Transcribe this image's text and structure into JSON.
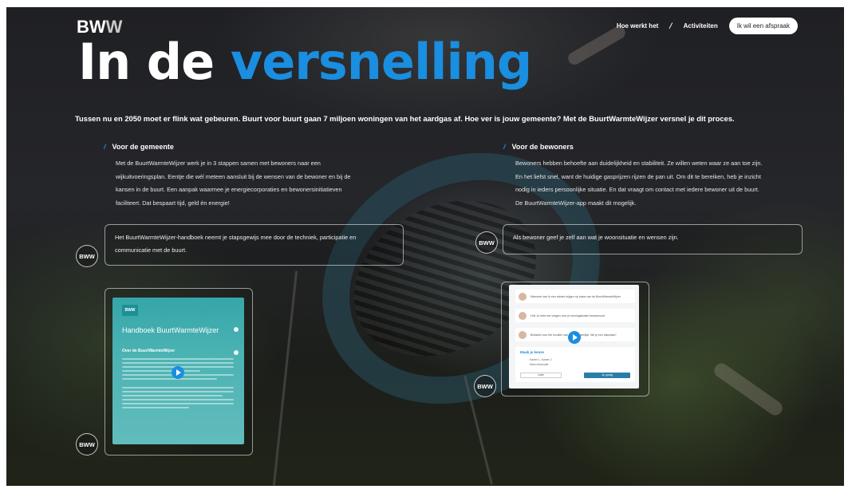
{
  "brand": {
    "logo_text_main": "BW",
    "logo_text_w": "W"
  },
  "nav": {
    "link_how": "Hoe werkt het",
    "separator": "/",
    "link_activities": "Activiteiten",
    "cta": "Ik wil een afspraak"
  },
  "hero": {
    "title_part1": "In de",
    "title_accent": "versnelling"
  },
  "intro": "Tussen nu en 2050 moet er flink wat gebeuren. Buurt voor buurt gaan 7 miljoen woningen van het aardgas af. Hoe ver is jouw gemeente? Met de BuurtWarmteWijzer versnel je dit proces.",
  "gemeente": {
    "heading": "Voor de gemeente",
    "lines": [
      "Met de BuurtWarmteWijzer werk je in 3 stappen samen met bewoners naar een",
      "wijkuitvoeringsplan. Eentje die wél meteen aansluit bij de wensen van de bewoner en bij de",
      "kansen in de buurt. Een aanpak waarmee je energiecorporaties en bewonersinitiatieven",
      "faciliteert. Dat bespaart tijd, geld én energie!"
    ],
    "bubble_lines": [
      "Het BuurtWarmteWijzer-handboek neemt je stapsgewijs mee door de techniek, participatie en",
      "communicatie met de buurt."
    ],
    "badge": "BWW",
    "book": {
      "logo": "BWW",
      "title": "Handboek BuurtWarmteWijzer",
      "section": "Over de BuurtWarmteWijzer"
    }
  },
  "bewoners": {
    "heading": "Voor de bewoners",
    "lines": [
      "Bewoners hebben behoefte aan duidelijkheid en stabiliteit. Ze willen weten waar ze aan toe zijn.",
      "En het liefst snel, want de huidige gasprijzen rijzen de pan uit. Om dit te bereiken, heb je inzicht",
      "nodig in ieders persoonlijke situatie. En dat vraagt om contact met iedere bewoner uit de buurt.",
      "De BuurtWarmteWijzer-app maakt dit mogelijk."
    ],
    "bubble": "Als bewoner geef je zelf aan wat je woonsituatie en wensen zijn.",
    "badge": "BWW",
    "app": {
      "chat1": "Wanneer kan ik een advies krijgen op basis van de BuurtWarmteWijzer",
      "chat2": "Hoi! Je hebt wel vragen over je woningsituatie beantwoord",
      "chat3": "Bedankt voor het invullen van onze vragenlijst. Wil je een afspraak?",
      "card_title": "Maak je keuze",
      "card_line1": "Kamer 1, Kamer 2",
      "card_line2": "Meer informatie",
      "btn_a": "Later",
      "btn_b": "Ja, graag"
    }
  },
  "colors": {
    "accent": "#1a8ee0",
    "teal": "#4cb3b3"
  }
}
